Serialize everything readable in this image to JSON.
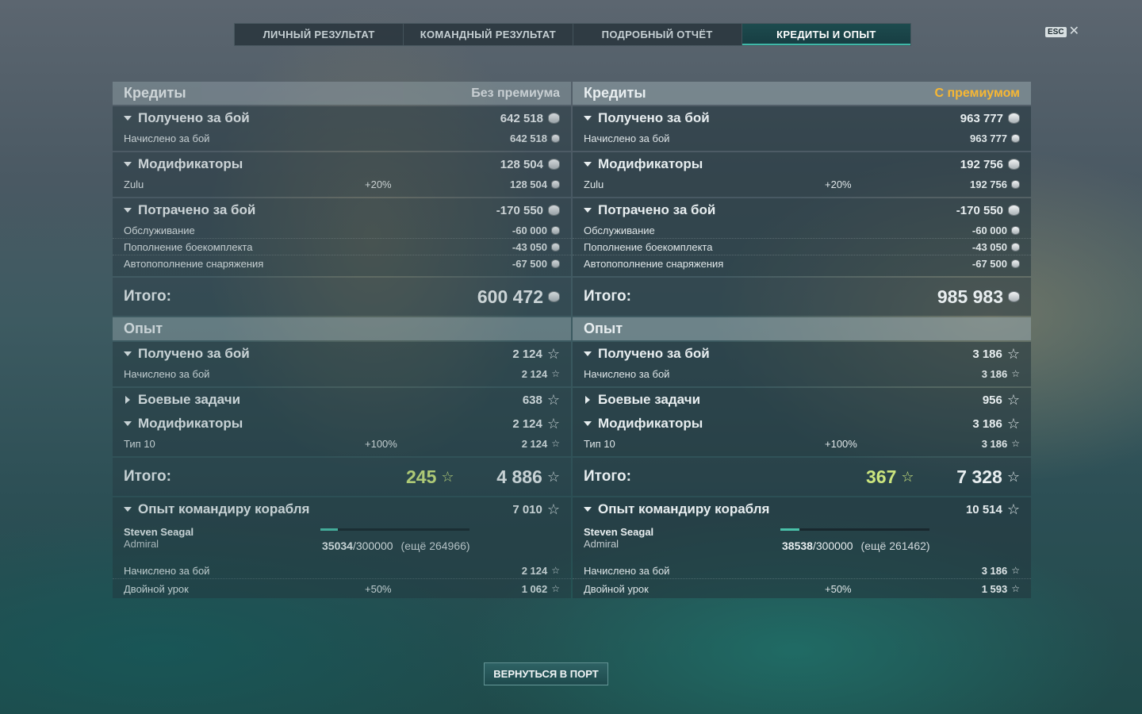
{
  "tabs": [
    "ЛИЧНЫЙ РЕЗУЛЬТАТ",
    "КОМАНДНЫЙ РЕЗУЛЬТАТ",
    "ПОДРОБНЫЙ ОТЧЁТ",
    "КРЕДИТЫ И ОПЫТ"
  ],
  "esc": "ESC",
  "left": {
    "credits_title": "Кредиты",
    "mode": "Без премиума",
    "earned_label": "Получено за бой",
    "earned": "642 518",
    "accrued_label": "Начислено за бой",
    "accrued": "642 518",
    "mods_label": "Модификаторы",
    "mods": "128 504",
    "mod_name": "Zulu",
    "mod_pct": "+20%",
    "mod_val": "128 504",
    "spent_label": "Потрачено за бой",
    "spent": "-170 550",
    "service_label": "Обслуживание",
    "service": "-60 000",
    "ammo_label": "Пополнение боекомплекта",
    "ammo": "-43 050",
    "supply_label": "Автопополнение снаряжения",
    "supply": "-67 500",
    "total_label": "Итого:",
    "total": "600 472",
    "xp_title": "Опыт",
    "xp_earned": "2 124",
    "xp_accrued": "2 124",
    "missions_label": "Боевые задачи",
    "missions": "638",
    "xp_mods": "2 124",
    "xp_mod_name": "Тип 10",
    "xp_mod_pct": "+100%",
    "xp_mod_val": "2 124",
    "xp_free": "245",
    "xp_total": "4 886",
    "cmd_label": "Опыт командиру корабля",
    "cmd_total": "7 010",
    "cmd_name": "Steven Seagal",
    "cmd_rank": "Admiral",
    "cmd_xp": "35034",
    "cmd_max": "/300000",
    "cmd_rest": "(ещё 264966)",
    "cmd_progress": 0.117,
    "cmd_accrued": "2 124",
    "double_label": "Двойной урок",
    "double_pct": "+50%",
    "double_val": "1 062"
  },
  "right": {
    "credits_title": "Кредиты",
    "mode": "С премиумом",
    "earned_label": "Получено за бой",
    "earned": "963 777",
    "accrued_label": "Начислено за бой",
    "accrued": "963 777",
    "mods_label": "Модификаторы",
    "mods": "192 756",
    "mod_name": "Zulu",
    "mod_pct": "+20%",
    "mod_val": "192 756",
    "spent_label": "Потрачено за бой",
    "spent": "-170 550",
    "service_label": "Обслуживание",
    "service": "-60 000",
    "ammo_label": "Пополнение боекомплекта",
    "ammo": "-43 050",
    "supply_label": "Автопополнение снаряжения",
    "supply": "-67 500",
    "total_label": "Итого:",
    "total": "985 983",
    "xp_title": "Опыт",
    "xp_earned": "3 186",
    "xp_accrued": "3 186",
    "missions_label": "Боевые задачи",
    "missions": "956",
    "xp_mods": "3 186",
    "xp_mod_name": "Тип 10",
    "xp_mod_pct": "+100%",
    "xp_mod_val": "3 186",
    "xp_free": "367",
    "xp_total": "7 328",
    "cmd_label": "Опыт командиру корабля",
    "cmd_total": "10 514",
    "cmd_name": "Steven Seagal",
    "cmd_rank": "Admiral",
    "cmd_xp": "38538",
    "cmd_max": "/300000",
    "cmd_rest": "(ещё 261462)",
    "cmd_progress": 0.128,
    "cmd_accrued": "3 186",
    "double_label": "Двойной урок",
    "double_pct": "+50%",
    "double_val": "1 593"
  },
  "return_button": "ВЕРНУТЬСЯ В ПОРТ",
  "colors": {
    "premium": "#f7b733",
    "free_xp": "#cbe57e",
    "accent": "#3fb8a8"
  },
  "icons": {
    "credits": "coin-icon",
    "xp": "star-icon"
  }
}
